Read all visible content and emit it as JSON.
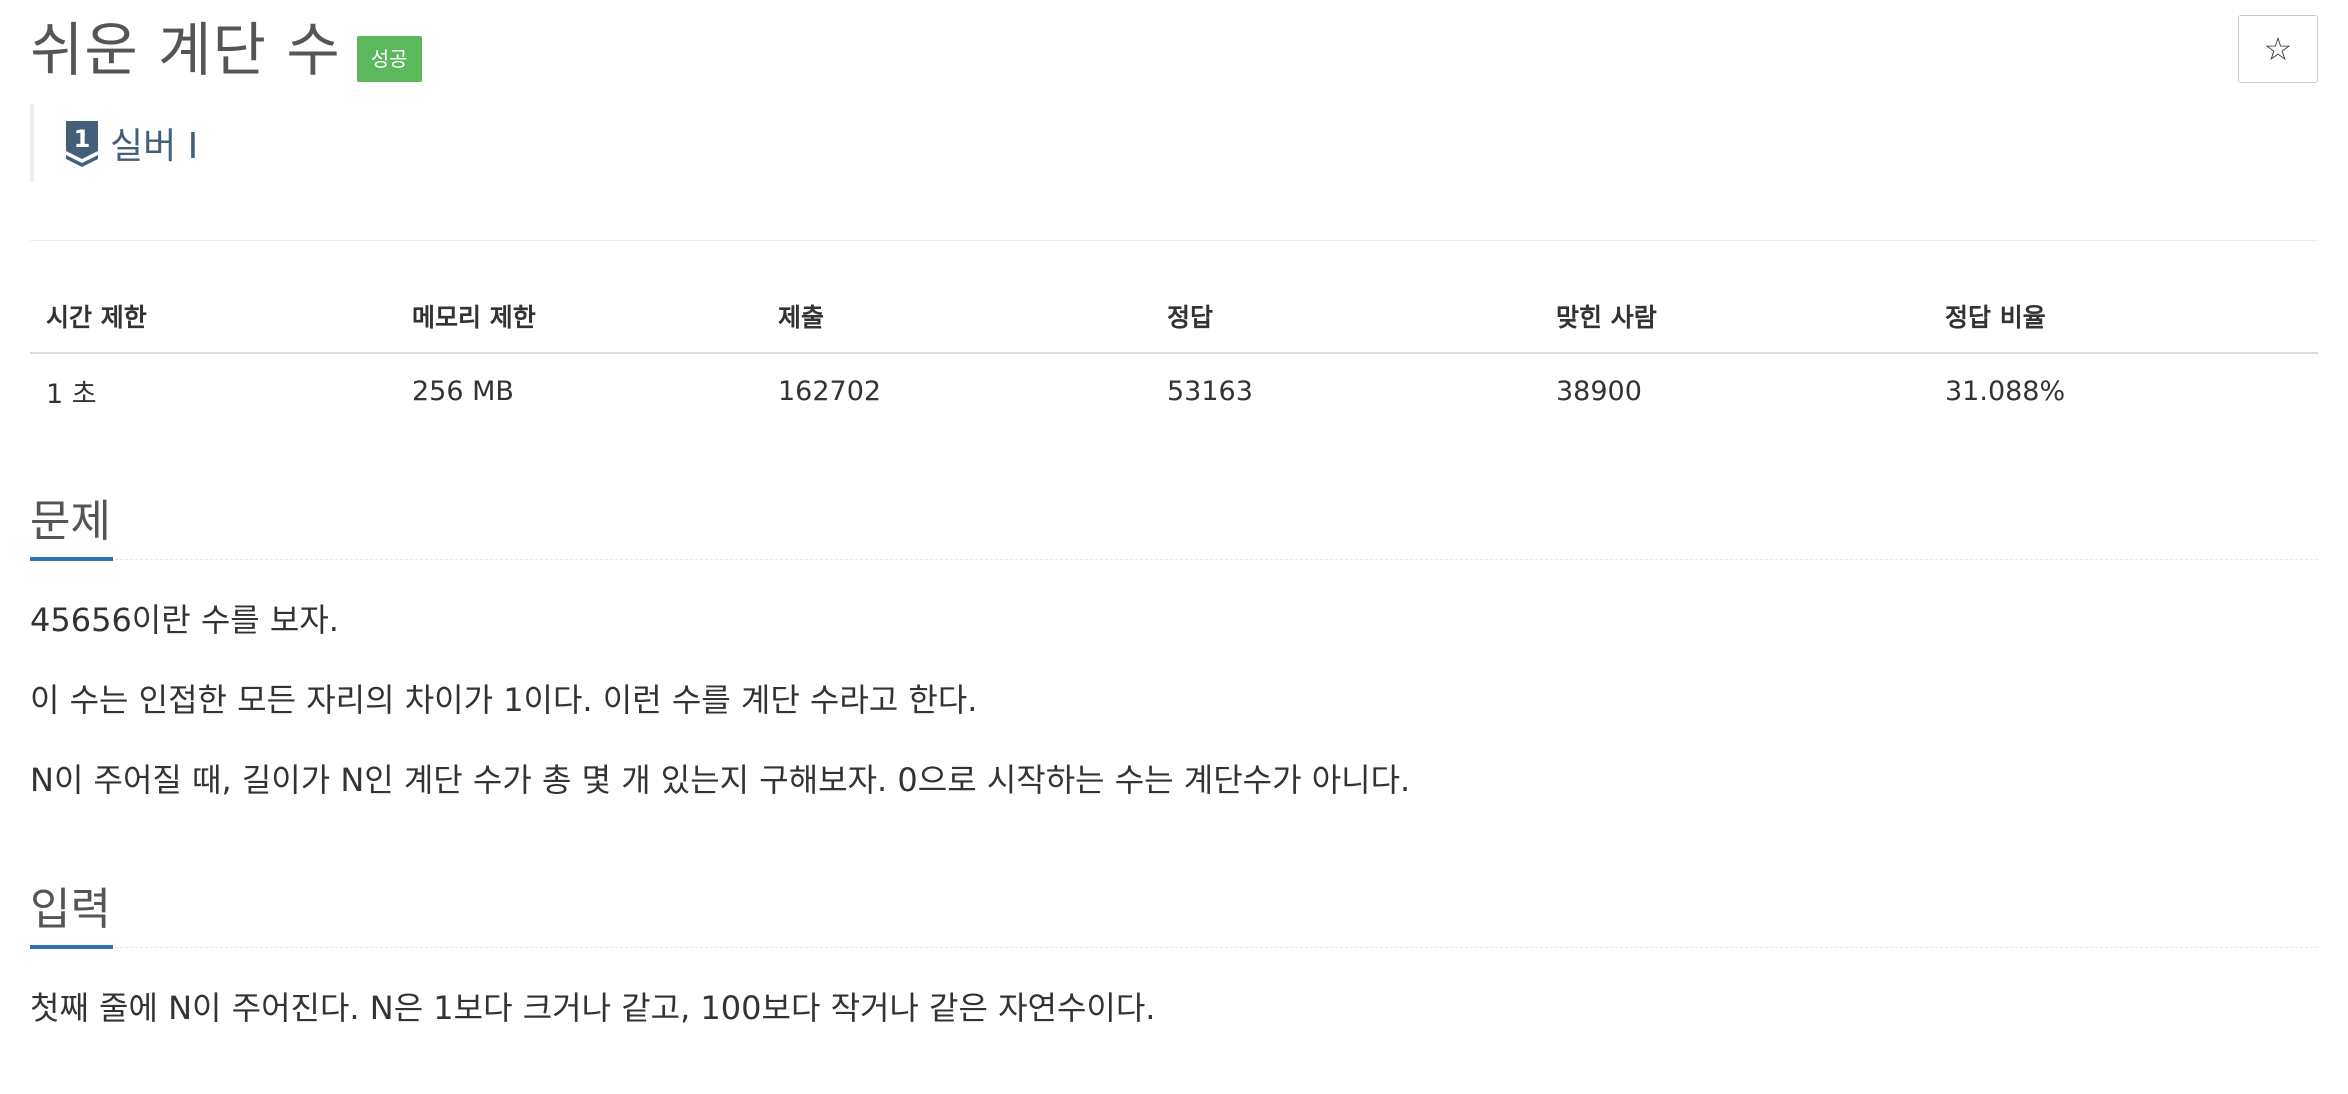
{
  "problem": {
    "title": "쉬운 계단 수",
    "result_badge": "성공",
    "star_icon": "☆",
    "tier": {
      "icon": "silver-tier-icon",
      "number": "1",
      "label": "실버 I",
      "color": "#435f7a"
    }
  },
  "stats": {
    "headers": [
      "시간 제한",
      "메모리 제한",
      "제출",
      "정답",
      "맞힌 사람",
      "정답 비율"
    ],
    "values": [
      "1 초",
      "256 MB",
      "162702",
      "53163",
      "38900",
      "31.088%"
    ]
  },
  "sections": {
    "problem": {
      "title": "문제",
      "paragraphs": [
        "45656이란 수를 보자.",
        "이 수는 인접한 모든 자리의 차이가 1이다. 이런 수를 계단 수라고 한다.",
        "N이 주어질 때, 길이가 N인 계단 수가 총 몇 개 있는지 구해보자. 0으로 시작하는 수는 계단수가 아니다."
      ]
    },
    "input": {
      "title": "입력",
      "paragraphs": [
        "첫째 줄에 N이 주어진다. N은 1보다 크거나 같고, 100보다 작거나 같은 자연수이다."
      ]
    }
  },
  "colors": {
    "accent": "#2e74b5",
    "success": "#5cb85c"
  }
}
